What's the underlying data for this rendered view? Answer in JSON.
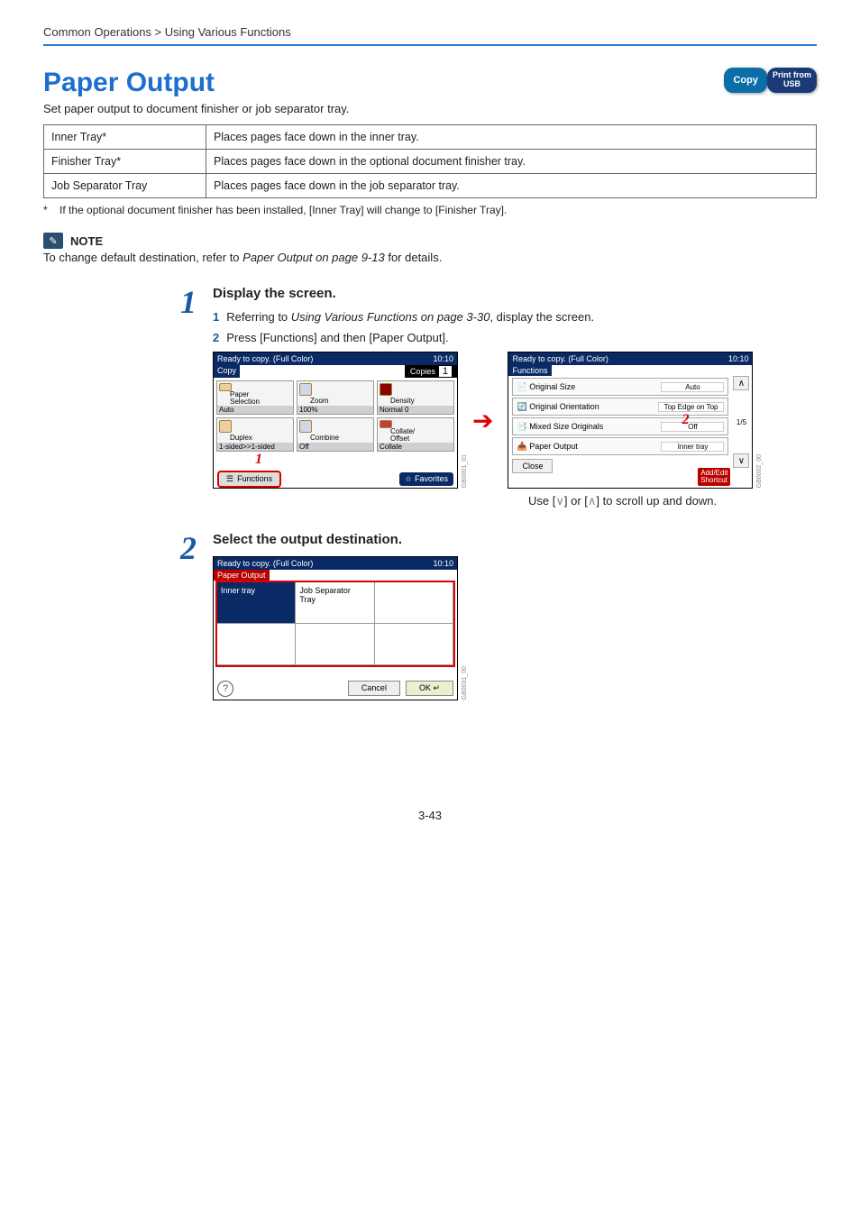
{
  "breadcrumb": "Common Operations > Using Various Functions",
  "title": "Paper Output",
  "subtitle": "Set paper output to document finisher or job separator tray.",
  "badges": {
    "copy": "Copy",
    "usb": "Print from\nUSB"
  },
  "table": [
    {
      "name": "Inner Tray*",
      "desc": "Places pages face down in the inner tray."
    },
    {
      "name": "Finisher Tray*",
      "desc": "Places pages face down in the optional document finisher tray."
    },
    {
      "name": "Job Separator Tray",
      "desc": "Places pages face down in the job separator tray."
    }
  ],
  "footnote_mark": "*",
  "footnote": "If the optional document finisher has been installed, [Inner Tray] will change to [Finisher Tray].",
  "note_label": "NOTE",
  "note_body_pre": "To change default destination, refer to ",
  "note_body_link": "Paper Output on page 9-13",
  "note_body_post": " for details.",
  "step1": {
    "num": "1",
    "title": "Display the screen.",
    "items": [
      {
        "n": "1",
        "pre": "Referring to ",
        "link": "Using Various Functions on page 3-30",
        "post": ", display the screen."
      },
      {
        "n": "2",
        "pre": "Press [Functions] and then [Paper Output].",
        "link": "",
        "post": ""
      }
    ]
  },
  "panel_copy": {
    "status": "Ready to copy. (Full Color)",
    "time": "10:10",
    "tab": "Copy",
    "copies_label": "Copies",
    "copies_n": "1",
    "tiles": [
      {
        "label": "Paper\nSelection",
        "sub": "Auto"
      },
      {
        "label": "Zoom",
        "sub": "100%"
      },
      {
        "label": "Density",
        "sub": "Normal 0"
      },
      {
        "label": "Duplex",
        "sub": "1-sided>>1-sided"
      },
      {
        "label": "Combine",
        "sub": "Off"
      },
      {
        "label": "Collate/\nOffset",
        "sub": "Collate"
      }
    ],
    "functions": "Functions",
    "favorites": "Favorites",
    "callout": "1",
    "code": "GB0001_01"
  },
  "panel_func": {
    "status": "Ready to copy. (Full Color)",
    "time": "10:10",
    "tab": "Functions",
    "rows": [
      {
        "label": "Original Size",
        "val": "Auto"
      },
      {
        "label": "Original Orientation",
        "val": "Top Edge on Top"
      },
      {
        "label": "Mixed Size Originals",
        "val": "Off"
      },
      {
        "label": "Paper Output",
        "val": "Inner tray"
      }
    ],
    "page": "1/5",
    "close": "Close",
    "addshort": "Add/Edit\nShortcut",
    "callout": "2",
    "code": "GB0002_00"
  },
  "caption_scroll": "Use [∨] or [∧] to scroll up and down.",
  "step2": {
    "num": "2",
    "title": "Select the output destination."
  },
  "panel_out": {
    "status": "Ready to copy. (Full Color)",
    "time": "10:10",
    "tab": "Paper Output",
    "cells": [
      "Inner tray",
      "Job Separator\nTray",
      ""
    ],
    "cancel": "Cancel",
    "ok": "OK",
    "code": "GB0031_00"
  },
  "page_number": "3-43"
}
